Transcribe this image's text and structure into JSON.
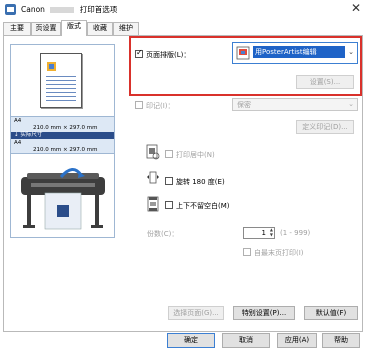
{
  "window": {
    "title_brand": "Canon",
    "title_suffix": "打印首选项",
    "close_glyph": "✕"
  },
  "tabs": [
    {
      "label": "主要"
    },
    {
      "label": "页设置"
    },
    {
      "label": "版式"
    },
    {
      "label": "收藏"
    },
    {
      "label": "维护"
    }
  ],
  "preview": {
    "size_top": "A4",
    "size_top_dims": "210.0 mm × 297.0 mm",
    "arrow_label": "实际尺寸",
    "size_bottom": "A4",
    "size_bottom_dims": "210.0 mm × 297.0 mm"
  },
  "layout": {
    "page_layout_label": "页面排版(L)：",
    "page_layout_value": "用PosterArtist编辑",
    "settings_button": "设置(S)..."
  },
  "stamp": {
    "label": "印记(I)：",
    "value": "保密",
    "define_button": "定义印记(D)..."
  },
  "options": {
    "center_label": "打印居中(N)",
    "rotate_label": "旋转 180 度(E)",
    "upside_label": "上下不留空白(M)"
  },
  "copies": {
    "label": "份数(C)：",
    "value": "1",
    "range": "(1 - 999)",
    "last_page_label": "自最末页打印(I)"
  },
  "panel_buttons": {
    "select_page": "选择页面(G)...",
    "special": "特别设置(P)...",
    "defaults": "默认值(F)"
  },
  "dialog_buttons": {
    "ok": "确定",
    "cancel": "取消",
    "apply": "应用(A)",
    "help": "帮助"
  }
}
